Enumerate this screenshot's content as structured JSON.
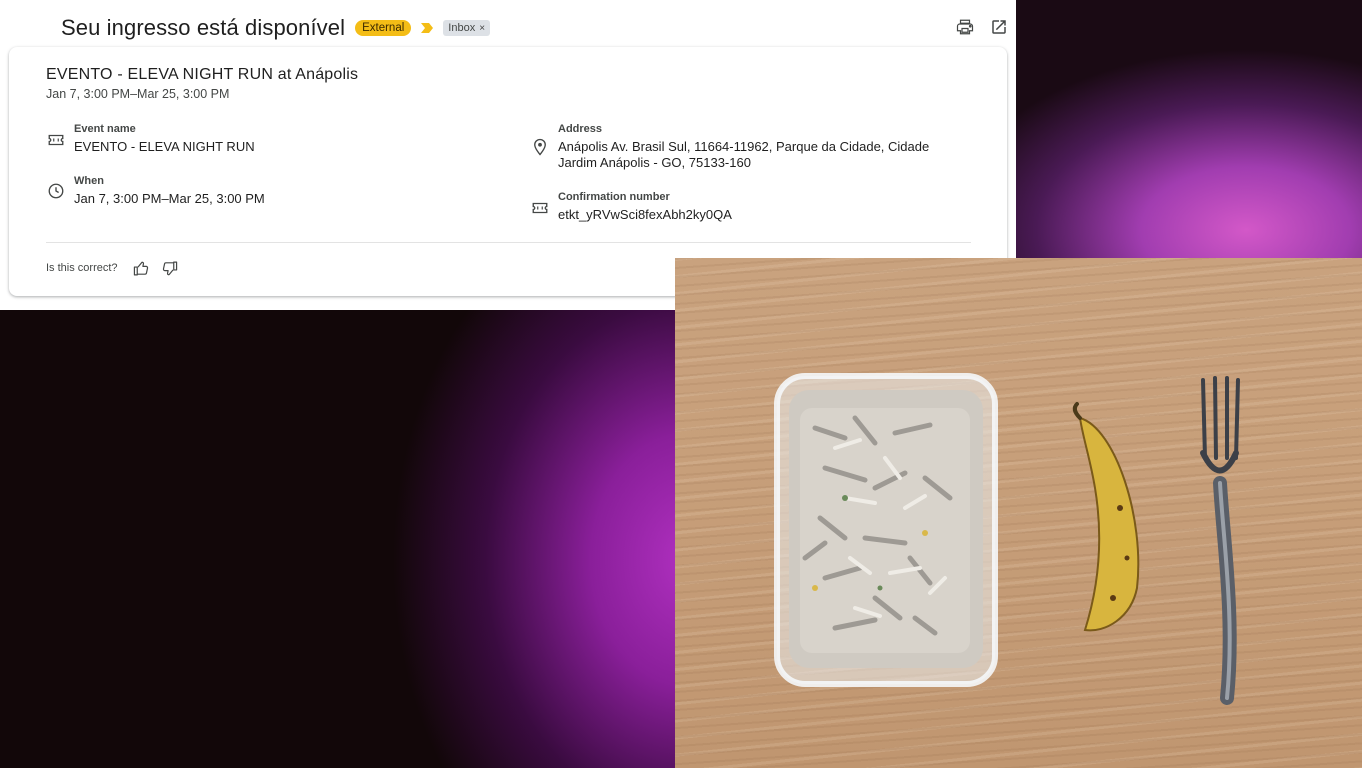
{
  "email": {
    "subject": "Seu ingresso está disponível",
    "labels": {
      "external": "External",
      "inbox": "Inbox",
      "inbox_remove": "×"
    },
    "icons": [
      "importance-marker-icon",
      "print-icon",
      "open-new-window-icon"
    ]
  },
  "card": {
    "title": "EVENTO - ELEVA NIGHT RUN at Anápolis",
    "subtitle": "Jan 7, 3:00 PM–Mar 25, 3:00 PM",
    "event_name": {
      "label": "Event name",
      "value": "EVENTO - ELEVA NIGHT RUN"
    },
    "when": {
      "label": "When",
      "value": "Jan 7, 3:00 PM–Mar 25, 3:00 PM"
    },
    "address": {
      "label": "Address",
      "line1": "Anápolis Av. Brasil Sul, 11664-11962, Parque da Cidade, Cidade",
      "line2": "Jardim Anápolis - GO, 75133-160"
    },
    "confirmation": {
      "label": "Confirmation number",
      "value": "etkt_yRVwSci8fexAbh2ky0QA"
    },
    "feedback": {
      "question": "Is this correct?"
    }
  },
  "colors": {
    "external_label": "#f4bd16",
    "importance": "#f4bd16",
    "inbox_label": "#dde1e6",
    "wood": "#c79f7a"
  },
  "photo": {
    "items": [
      "plastic-food-container",
      "banana",
      "fork"
    ]
  }
}
